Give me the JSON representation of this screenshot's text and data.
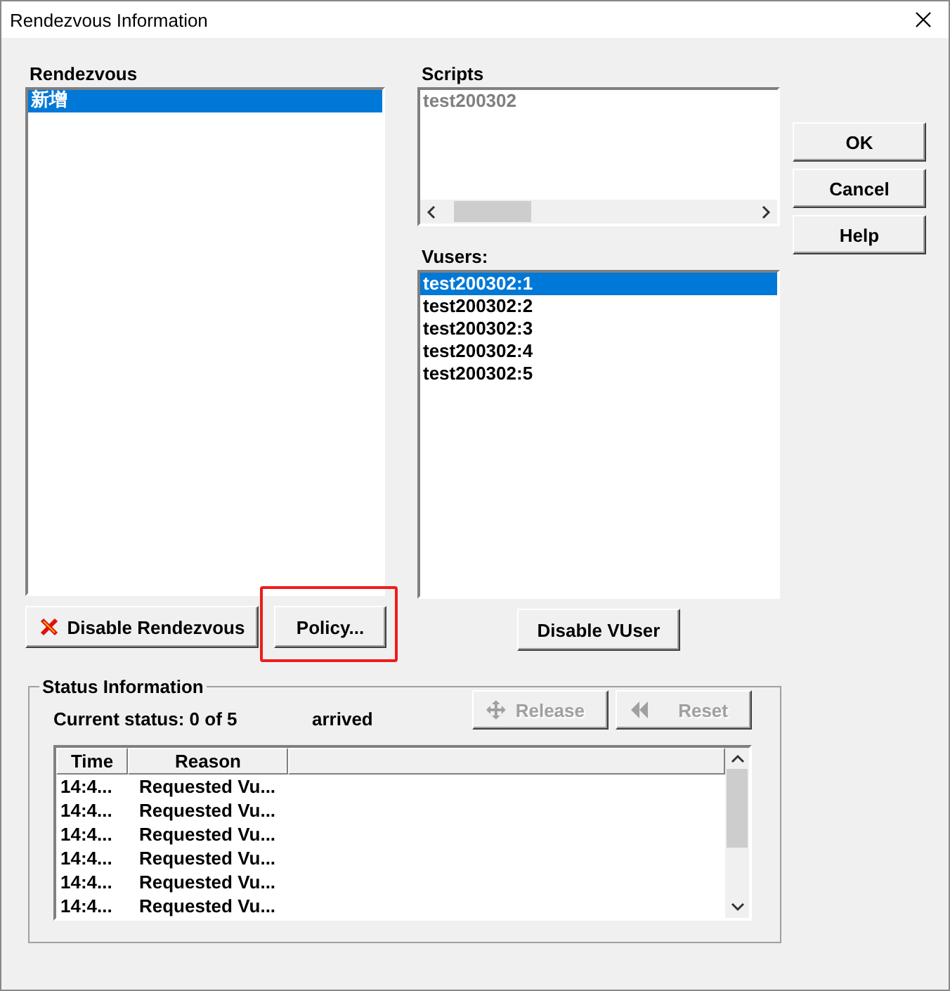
{
  "window": {
    "title": "Rendezvous Information"
  },
  "rendezvous": {
    "label": "Rendezvous",
    "items": [
      {
        "label": "新增",
        "selected": true
      }
    ],
    "buttons": [
      {
        "kind": "disable",
        "label": "Disable Rendezvous",
        "highlighted": false
      },
      {
        "kind": "plain",
        "label": "Policy...",
        "highlighted": true
      }
    ]
  },
  "scripts": {
    "label": "Scripts",
    "disabled": true,
    "items": [
      "test200302"
    ]
  },
  "vusers": {
    "label": "Vusers:",
    "items": [
      {
        "label": "test200302:1",
        "selected": true
      },
      {
        "label": "test200302:2",
        "selected": false
      },
      {
        "label": "test200302:3",
        "selected": false
      },
      {
        "label": "test200302:4",
        "selected": false
      },
      {
        "label": "test200302:5",
        "selected": false
      }
    ],
    "button": "Disable VUser"
  },
  "dialog_buttons": [
    "OK",
    "Cancel",
    "Help"
  ],
  "status": {
    "title": "Status Information",
    "current_status": "Current status: 0 of 5",
    "state": "arrived",
    "actions": [
      {
        "kind": "release",
        "label": "Release",
        "disabled": true
      },
      {
        "kind": "reset",
        "label": "Reset",
        "disabled": true
      }
    ],
    "columns": [
      "Time",
      "Reason"
    ],
    "rows": [
      {
        "time": "14:4...",
        "reason": "Requested Vu..."
      },
      {
        "time": "14:4...",
        "reason": "Requested Vu..."
      },
      {
        "time": "14:4...",
        "reason": "Requested Vu..."
      },
      {
        "time": "14:4...",
        "reason": "Requested Vu..."
      },
      {
        "time": "14:4...",
        "reason": "Requested Vu..."
      },
      {
        "time": "14:4...",
        "reason": "Requested Vu..."
      }
    ]
  }
}
